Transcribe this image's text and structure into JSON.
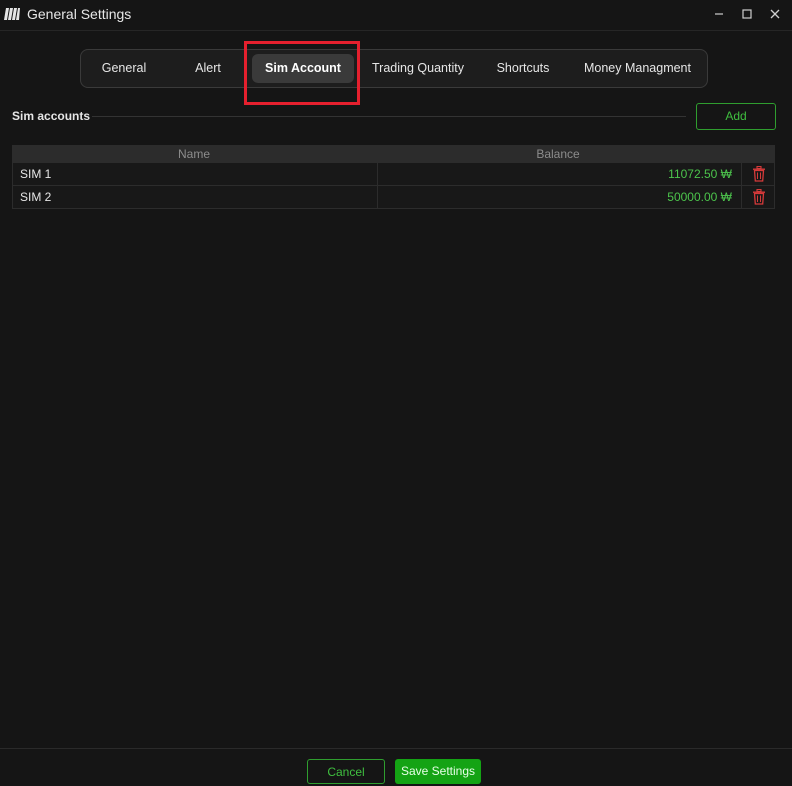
{
  "window": {
    "title": "General Settings",
    "logo_icon": "app-logo-icon"
  },
  "tabs": [
    {
      "label": "General",
      "active": false
    },
    {
      "label": "Alert",
      "active": false
    },
    {
      "label": "Sim Account",
      "active": true
    },
    {
      "label": "Trading Quantity",
      "active": false
    },
    {
      "label": "Shortcuts",
      "active": false
    },
    {
      "label": "Money Managment",
      "active": false
    }
  ],
  "section": {
    "title": "Sim accounts",
    "add_label": "Add"
  },
  "table": {
    "columns": [
      "Name",
      "Balance"
    ],
    "rows": [
      {
        "name": "SIM 1",
        "balance": "11072.50 ₩"
      },
      {
        "name": "SIM 2",
        "balance": "50000.00 ₩"
      }
    ]
  },
  "footer": {
    "cancel_label": "Cancel",
    "save_label": "Save Settings"
  },
  "colors": {
    "accent_green": "#3fbf3f",
    "save_bg": "#14a314",
    "delete_red": "#d63a3a",
    "highlight_red": "#e5202e"
  }
}
